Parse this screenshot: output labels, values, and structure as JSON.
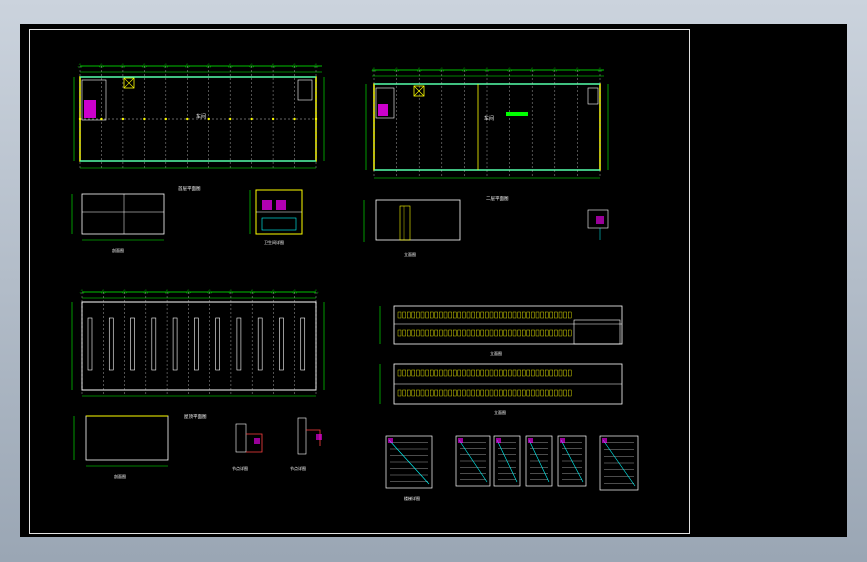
{
  "app": {
    "window": "CAD drawing viewer",
    "background_colors": [
      "#cbd3dd",
      "#9aa6b4"
    ],
    "canvas_color": "#000000",
    "palette": {
      "line_white": "#ffffff",
      "line_green": "#00ff00",
      "line_yellow": "#ffff00",
      "line_cyan": "#00ffff",
      "line_magenta": "#ff00ff",
      "line_red": "#ff4040"
    }
  },
  "drawing": {
    "views": [
      {
        "name": "首层平面图"
      },
      {
        "name": "二层平面图"
      },
      {
        "name": "屋顶平面图"
      },
      {
        "name": "立面图"
      },
      {
        "name": "剖面图"
      },
      {
        "name": "楼梯详图"
      },
      {
        "name": "卫生间详图"
      },
      {
        "name": "节点详图"
      }
    ],
    "room_label": "车间"
  }
}
